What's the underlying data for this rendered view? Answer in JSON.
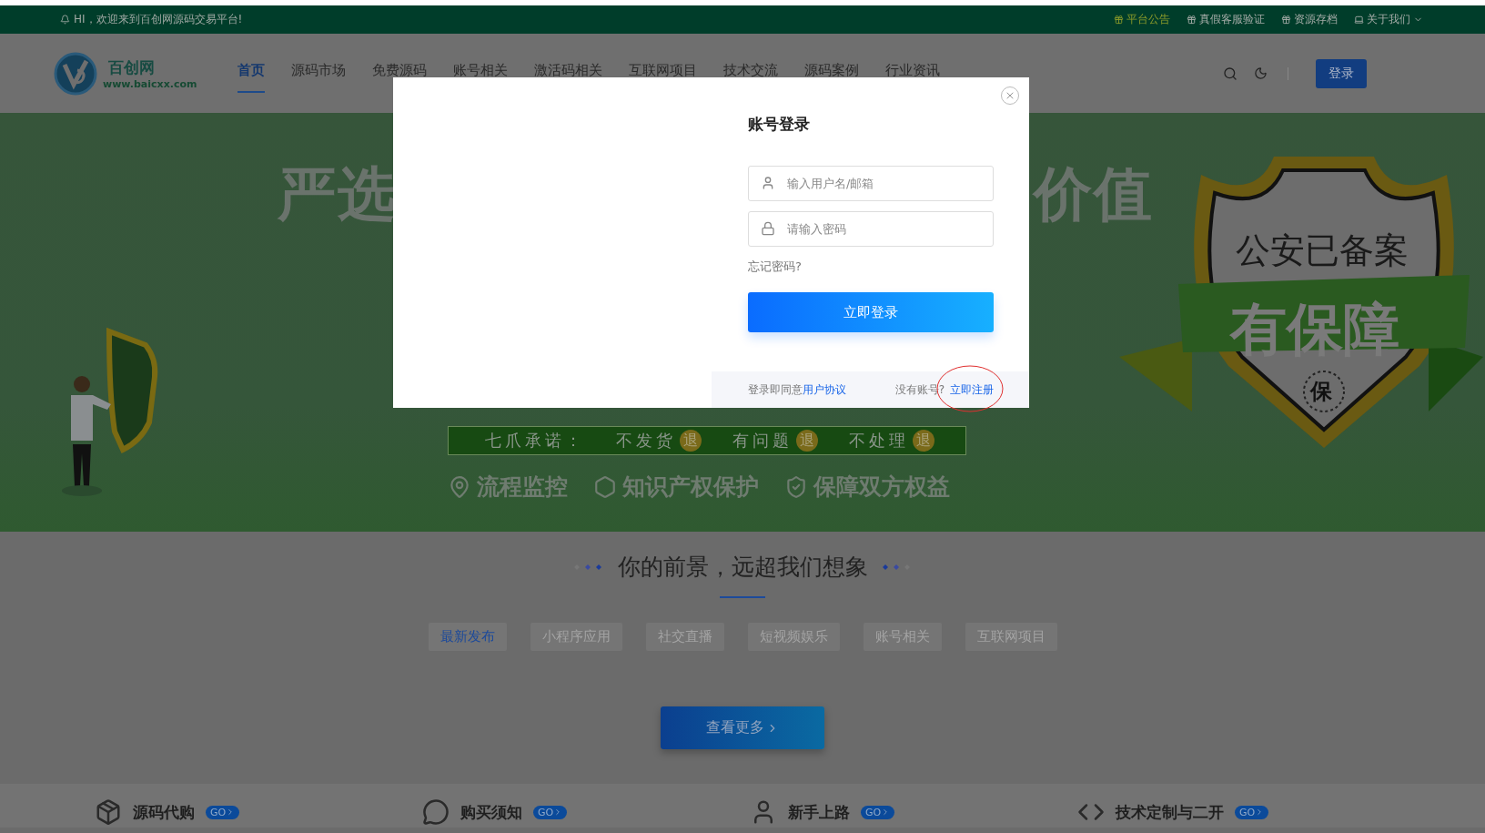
{
  "top_bar": {
    "greeting": "HI，欢迎来到百创网源码交易平台!",
    "links": [
      {
        "label": "平台公告",
        "selected": true
      },
      {
        "label": "真假客服验证",
        "selected": false
      },
      {
        "label": "资源存档",
        "selected": false
      },
      {
        "label": "关于我们",
        "selected": false,
        "dropdown": true
      }
    ]
  },
  "header": {
    "logo": {
      "name": "百创网",
      "url": "www.baicxx.com"
    },
    "nav": [
      {
        "label": "首页",
        "selected": true
      },
      {
        "label": "源码市场",
        "selected": false
      },
      {
        "label": "免费源码",
        "selected": false
      },
      {
        "label": "账号相关",
        "selected": false
      },
      {
        "label": "激活码相关",
        "selected": false
      },
      {
        "label": "互联网项目",
        "selected": false
      },
      {
        "label": "技术交流",
        "selected": false
      },
      {
        "label": "源码案例",
        "selected": false
      },
      {
        "label": "行业资讯",
        "selected": false
      }
    ],
    "login_button": "登录"
  },
  "banner": {
    "headline_left": "严选",
    "headline_right": "价值",
    "promise": {
      "label": "七爪承诺：",
      "items": [
        {
          "text": "不发货",
          "badge": "退"
        },
        {
          "text": "有问题",
          "badge": "退"
        },
        {
          "text": "不处理",
          "badge": "退"
        }
      ]
    },
    "features": [
      {
        "kind": "pin",
        "label": "流程监控"
      },
      {
        "kind": "registered",
        "label": "知识产权保护"
      },
      {
        "kind": "shield",
        "label": "保障双方权益"
      }
    ],
    "badge": {
      "top": "公安已备案",
      "ribbon": "有保障",
      "seal": "保"
    }
  },
  "section": {
    "title": "你的前景，远超我们想象",
    "tabs": [
      {
        "label": "最新发布",
        "selected": true
      },
      {
        "label": "小程序应用",
        "selected": false
      },
      {
        "label": "社交直播",
        "selected": false
      },
      {
        "label": "短视频娱乐",
        "selected": false
      },
      {
        "label": "账号相关",
        "selected": false
      },
      {
        "label": "互联网项目",
        "selected": false
      }
    ],
    "more_button": "查看更多"
  },
  "services": [
    {
      "kind": "box",
      "title": "源码代购",
      "badge": "GO"
    },
    {
      "kind": "chat",
      "title": "购买须知",
      "badge": "GO"
    },
    {
      "kind": "user",
      "title": "新手上路",
      "badge": "GO"
    },
    {
      "kind": "code",
      "title": "技术定制与二开",
      "badge": "GO"
    }
  ],
  "login_modal": {
    "title": "账号登录",
    "fields": [
      {
        "kind": "user",
        "placeholder": "输入用户名/邮箱"
      },
      {
        "kind": "password",
        "placeholder": "请输入密码"
      }
    ],
    "forgot": "忘记密码?",
    "submit": "立即登录",
    "agreement": {
      "text": "登录即同意",
      "link": "用户协议"
    },
    "register": {
      "text": "没有账号?",
      "link": "立即注册",
      "highlighted": true
    }
  }
}
